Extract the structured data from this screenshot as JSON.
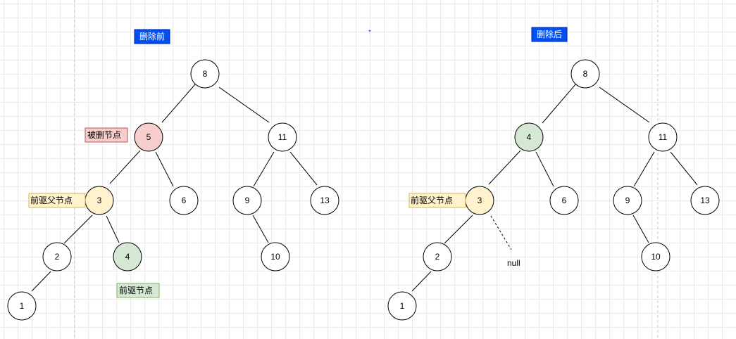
{
  "colors": {
    "title_fill": "#0050ef",
    "title_stroke": "#001dbc",
    "deleted_fill": "#f8cecc",
    "deleted_stroke": "#b85450",
    "pred_parent_fill": "#fff2cc",
    "pred_parent_stroke": "#d6b656",
    "pred_fill": "#d5e8d4",
    "pred_stroke": "#82b366",
    "plain_fill": "#ffffff",
    "guide": "#c0c0c0"
  },
  "before": {
    "title": "删除前",
    "nodes": [
      "8",
      "5",
      "11",
      "3",
      "6",
      "9",
      "13",
      "2",
      "4",
      "10",
      "1"
    ],
    "labels": {
      "deleted": "被删节点",
      "pred_parent": "前驱父节点",
      "pred": "前驱节点"
    }
  },
  "after": {
    "title": "删除后",
    "nodes": [
      "8",
      "4",
      "11",
      "3",
      "6",
      "9",
      "13",
      "2",
      "10",
      "1"
    ],
    "labels": {
      "pred_parent": "前驱父节点",
      "null_text": "null"
    }
  }
}
